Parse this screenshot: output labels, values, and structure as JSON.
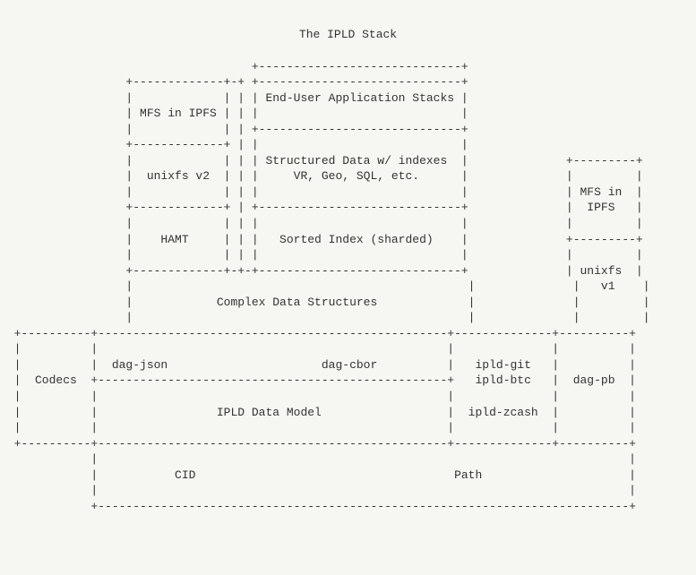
{
  "title": "The IPLD Stack",
  "boxes": {
    "mfs_ipfs_left": "MFS in IPFS",
    "end_user_stacks": "End-User Application Stacks",
    "unixfs_v2": "unixfs v2",
    "structured_l1": "Structured Data w/ indexes",
    "structured_l2": "VR, Geo, SQL, etc.",
    "hamt": "HAMT",
    "sorted_index": "Sorted Index (sharded)",
    "complex_ds": "Complex Data Structures",
    "codecs": "Codecs",
    "dag_json": "dag-json",
    "dag_cbor": "dag-cbor",
    "data_model": "IPLD Data Model",
    "ipld_git": "ipld-git",
    "ipld_btc": "ipld-btc",
    "ipld_zcash": "ipld-zcash",
    "dag_pb": "dag-pb",
    "mfs_right_l1": "MFS in",
    "mfs_right_l2": "IPFS",
    "unixfs_v1_l1": "unixfs",
    "unixfs_v1_l2": "v1",
    "cid": "CID",
    "path": "Path"
  }
}
